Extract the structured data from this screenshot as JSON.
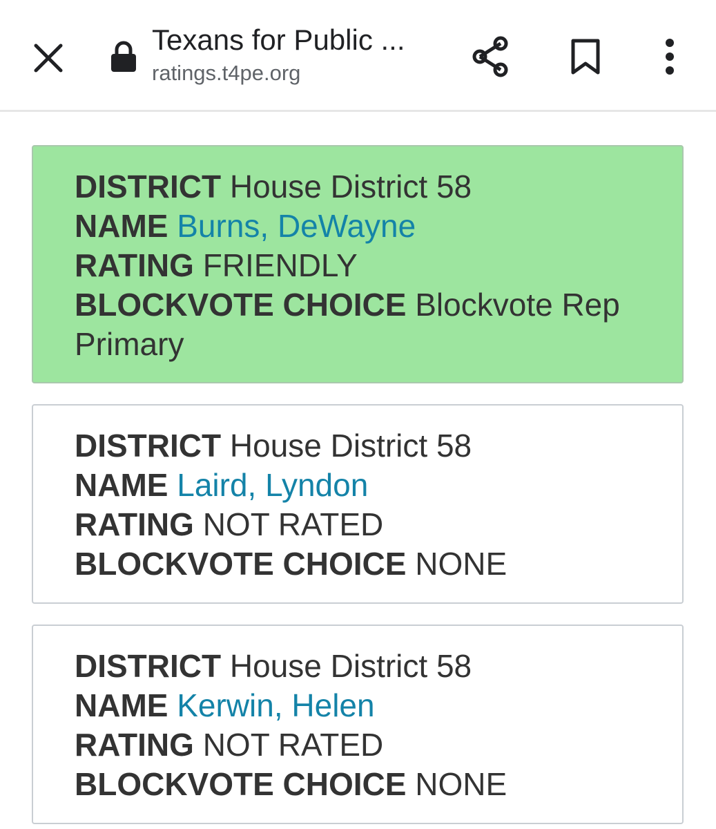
{
  "toolbar": {
    "title": "Texans for Public ...",
    "url": "ratings.t4pe.org"
  },
  "labels": {
    "district": "DISTRICT",
    "name": "NAME",
    "rating": "RATING",
    "blockvote": "BLOCKVOTE CHOICE"
  },
  "cards": [
    {
      "district": "House District 58",
      "name": "Burns, DeWayne",
      "rating": "FRIENDLY",
      "blockvote": "Blockvote Rep Primary",
      "background": "#9de59f"
    },
    {
      "district": "House District 58",
      "name": "Laird, Lyndon",
      "rating": "NOT RATED",
      "blockvote": "NONE",
      "background": "#ffffff"
    },
    {
      "district": "House District 58",
      "name": "Kerwin, Helen",
      "rating": "NOT RATED",
      "blockvote": "NONE",
      "background": "#ffffff"
    }
  ],
  "colors": {
    "link": "#1483a8",
    "friendly_bg": "#9de59f",
    "text": "#333333"
  },
  "icons": [
    "close-icon",
    "lock-icon",
    "share-icon",
    "bookmark-icon",
    "more-vert-icon"
  ]
}
